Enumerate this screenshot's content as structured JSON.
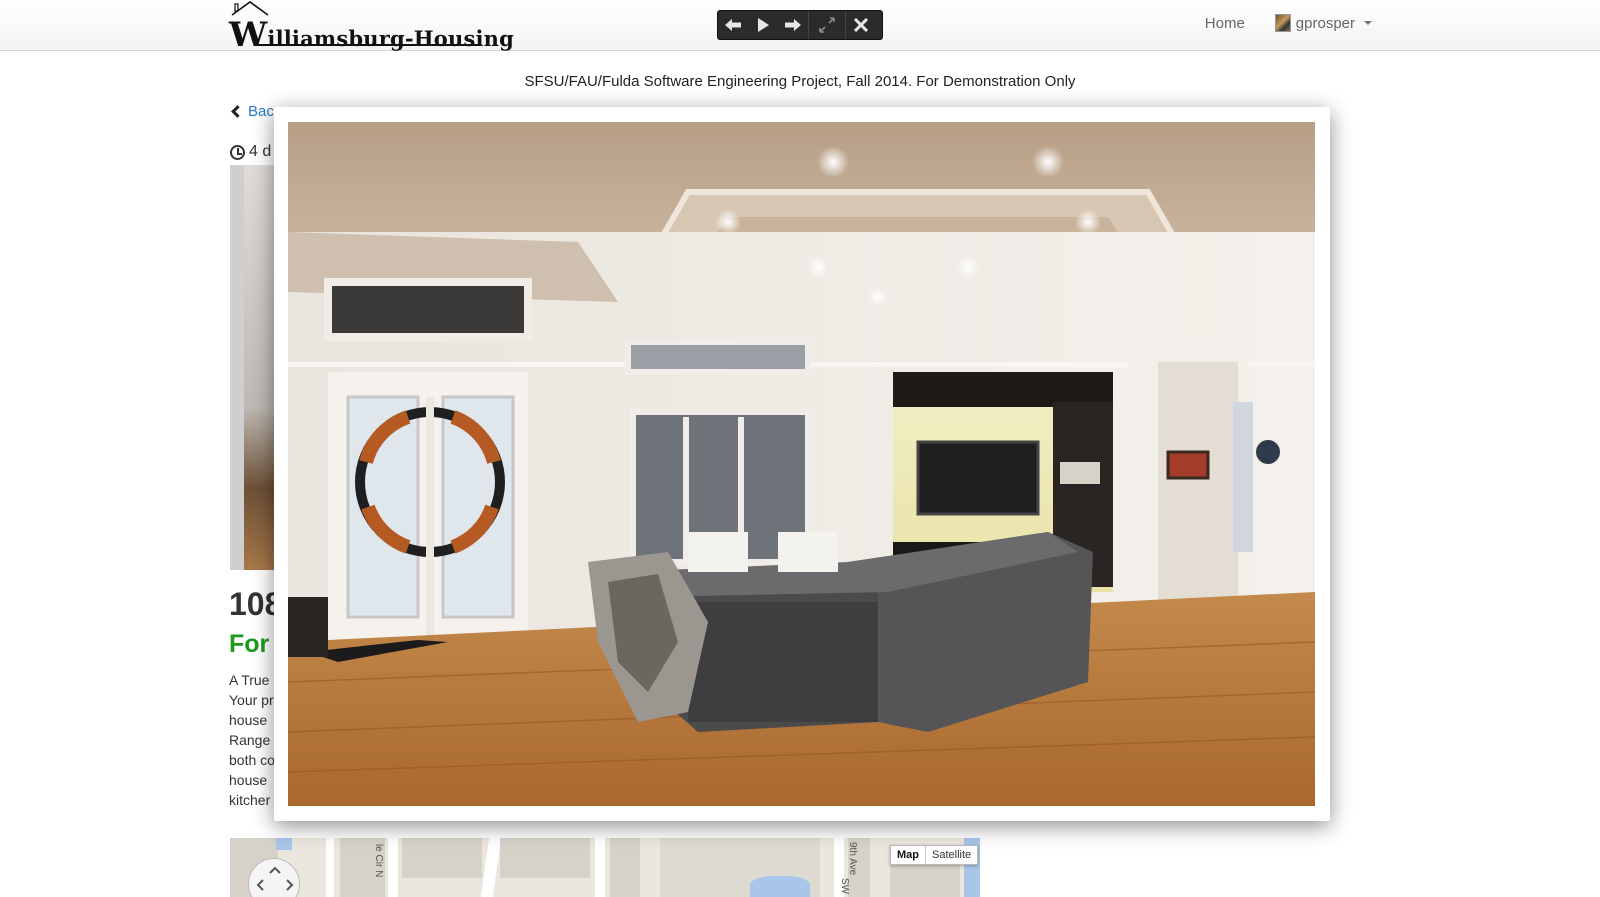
{
  "navbar": {
    "logo_initial": "W",
    "logo_rest": "illiamsburg-Housing",
    "home_label": "Home",
    "username": "gprosper"
  },
  "toolbar": {
    "buttons": [
      "previous",
      "play",
      "next",
      "fullscreen",
      "close"
    ]
  },
  "banner": "SFSU/FAU/Fulda Software Engineering Project, Fall 2014. For Demonstration Only",
  "listing": {
    "back_label": "Bac",
    "posted": "4 d",
    "price_partial": "108",
    "status_partial": "For",
    "description_partial": [
      "A True",
      "Your pr",
      "house",
      "Range",
      "both co",
      "house",
      "kitcher"
    ]
  },
  "map": {
    "type_options": [
      "Map",
      "Satellite"
    ],
    "street_labels": [
      "le Cir N",
      "9th Ave",
      "SW"
    ]
  },
  "colors": {
    "link": "#2a7ac8",
    "status_green": "#1e9a1e",
    "toolbar_bg": "#2b2b2b"
  },
  "modal": {
    "image_alt": "living room with sectional sofa, tray ceiling, stained glass double doors and TV wall unit"
  }
}
